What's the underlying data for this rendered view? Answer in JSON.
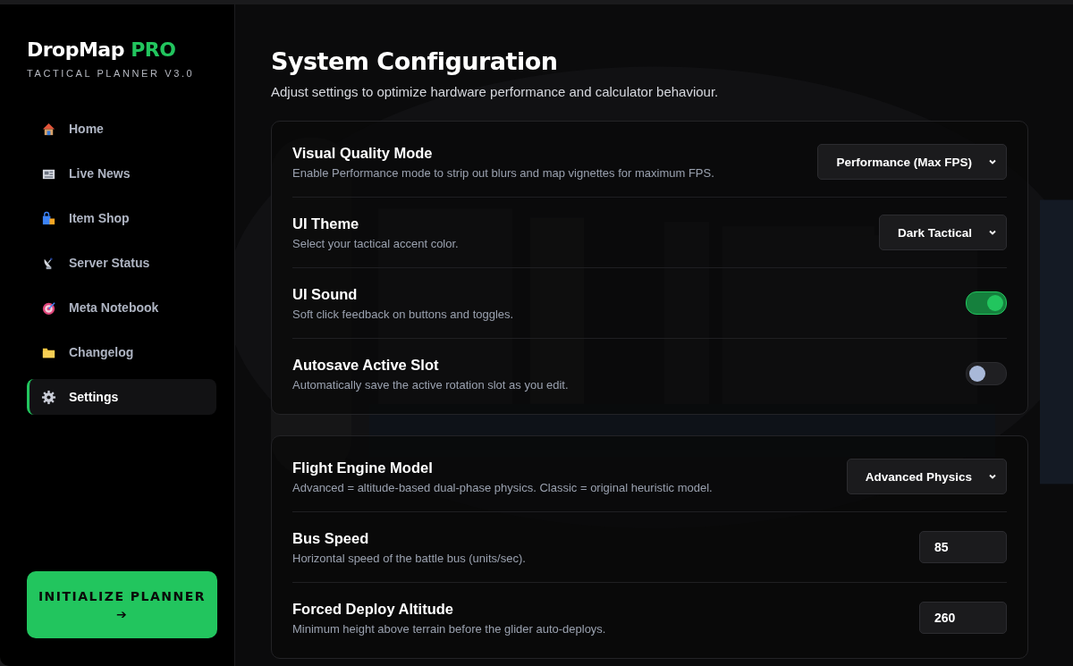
{
  "brand": {
    "name": "DropMap",
    "badge": "PRO",
    "subtitle": "TACTICAL PLANNER V3.0"
  },
  "sidebar": {
    "items": [
      {
        "label": "Home",
        "selected": false
      },
      {
        "label": "Live News",
        "selected": false
      },
      {
        "label": "Item Shop",
        "selected": false
      },
      {
        "label": "Server Status",
        "selected": false
      },
      {
        "label": "Meta Notebook",
        "selected": false
      },
      {
        "label": "Changelog",
        "selected": false
      },
      {
        "label": "Settings",
        "selected": true
      }
    ],
    "action_button": {
      "label": "INITIALIZE PLANNER",
      "arrow": "➔"
    }
  },
  "page": {
    "title": "System Configuration",
    "subtitle": "Adjust settings to optimize hardware performance and calculator behaviour."
  },
  "sections": [
    {
      "rows": [
        {
          "kind": "select",
          "label": "Visual Quality Mode",
          "description": "Enable Performance mode to strip out blurs and map vignettes for maximum FPS.",
          "value": "Performance (Max FPS)"
        },
        {
          "kind": "select",
          "label": "UI Theme",
          "description": "Select your tactical accent color.",
          "value": "Dark Tactical"
        },
        {
          "kind": "toggle",
          "label": "UI Sound",
          "description": "Soft click feedback on buttons and toggles.",
          "on": true
        },
        {
          "kind": "toggle",
          "label": "Autosave Active Slot",
          "description": "Automatically save the active rotation slot as you edit.",
          "on": false
        }
      ]
    },
    {
      "rows": [
        {
          "kind": "select",
          "label": "Flight Engine Model",
          "description": "Advanced = altitude-based dual-phase physics. Classic = original heuristic model.",
          "value": "Advanced Physics"
        },
        {
          "kind": "number",
          "label": "Bus Speed",
          "description": "Horizontal speed of the battle bus (units/sec).",
          "value": "85"
        },
        {
          "kind": "number",
          "label": "Forced Deploy Altitude",
          "description": "Minimum height above terrain before the glider auto-deploys.",
          "value": "260"
        }
      ]
    }
  ]
}
